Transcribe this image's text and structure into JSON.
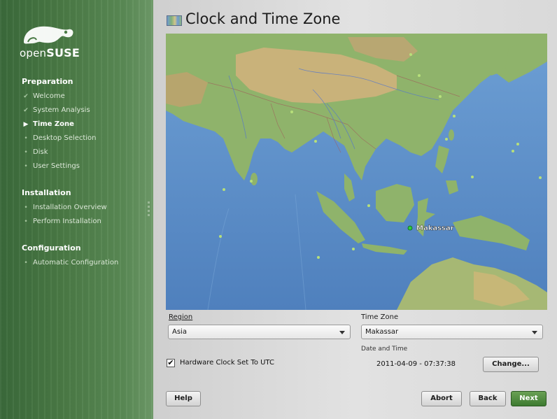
{
  "sidebar": {
    "logo_text_light": "open",
    "logo_text_bold": "SUSE",
    "sections": [
      {
        "title": "Preparation",
        "steps": [
          {
            "label": "Welcome",
            "state": "done"
          },
          {
            "label": "System Analysis",
            "state": "done"
          },
          {
            "label": "Time Zone",
            "state": "current"
          },
          {
            "label": "Desktop Selection",
            "state": "pending"
          },
          {
            "label": "Disk",
            "state": "pending"
          },
          {
            "label": "User Settings",
            "state": "pending"
          }
        ]
      },
      {
        "title": "Installation",
        "steps": [
          {
            "label": "Installation Overview",
            "state": "pending"
          },
          {
            "label": "Perform Installation",
            "state": "pending"
          }
        ]
      },
      {
        "title": "Configuration",
        "steps": [
          {
            "label": "Automatic Configuration",
            "state": "pending"
          }
        ]
      }
    ],
    "icons": {
      "done": "check-icon",
      "current": "arrow-right-icon",
      "pending": "bullet-icon"
    }
  },
  "main": {
    "title": "Clock and Time Zone",
    "title_icon": "world-map-icon",
    "map": {
      "selected_city": "Makassar",
      "colors": {
        "ocean": "#5d8fc8",
        "land": "#8fb36b",
        "highland": "#c9b27a",
        "selected_dot": "#2ecc40",
        "other_dot": "#b7e07a"
      }
    },
    "region": {
      "label": "Region",
      "value": "Asia"
    },
    "timezone": {
      "label": "Time Zone",
      "value": "Makassar"
    },
    "hardware_clock": {
      "label": "Hardware Clock Set To UTC",
      "checked": true
    },
    "datetime": {
      "label": "Date and Time",
      "value": "2011-04-09 - 07:37:38"
    },
    "buttons": {
      "change": "Change...",
      "help": "Help",
      "abort": "Abort",
      "back": "Back",
      "next": "Next"
    }
  }
}
